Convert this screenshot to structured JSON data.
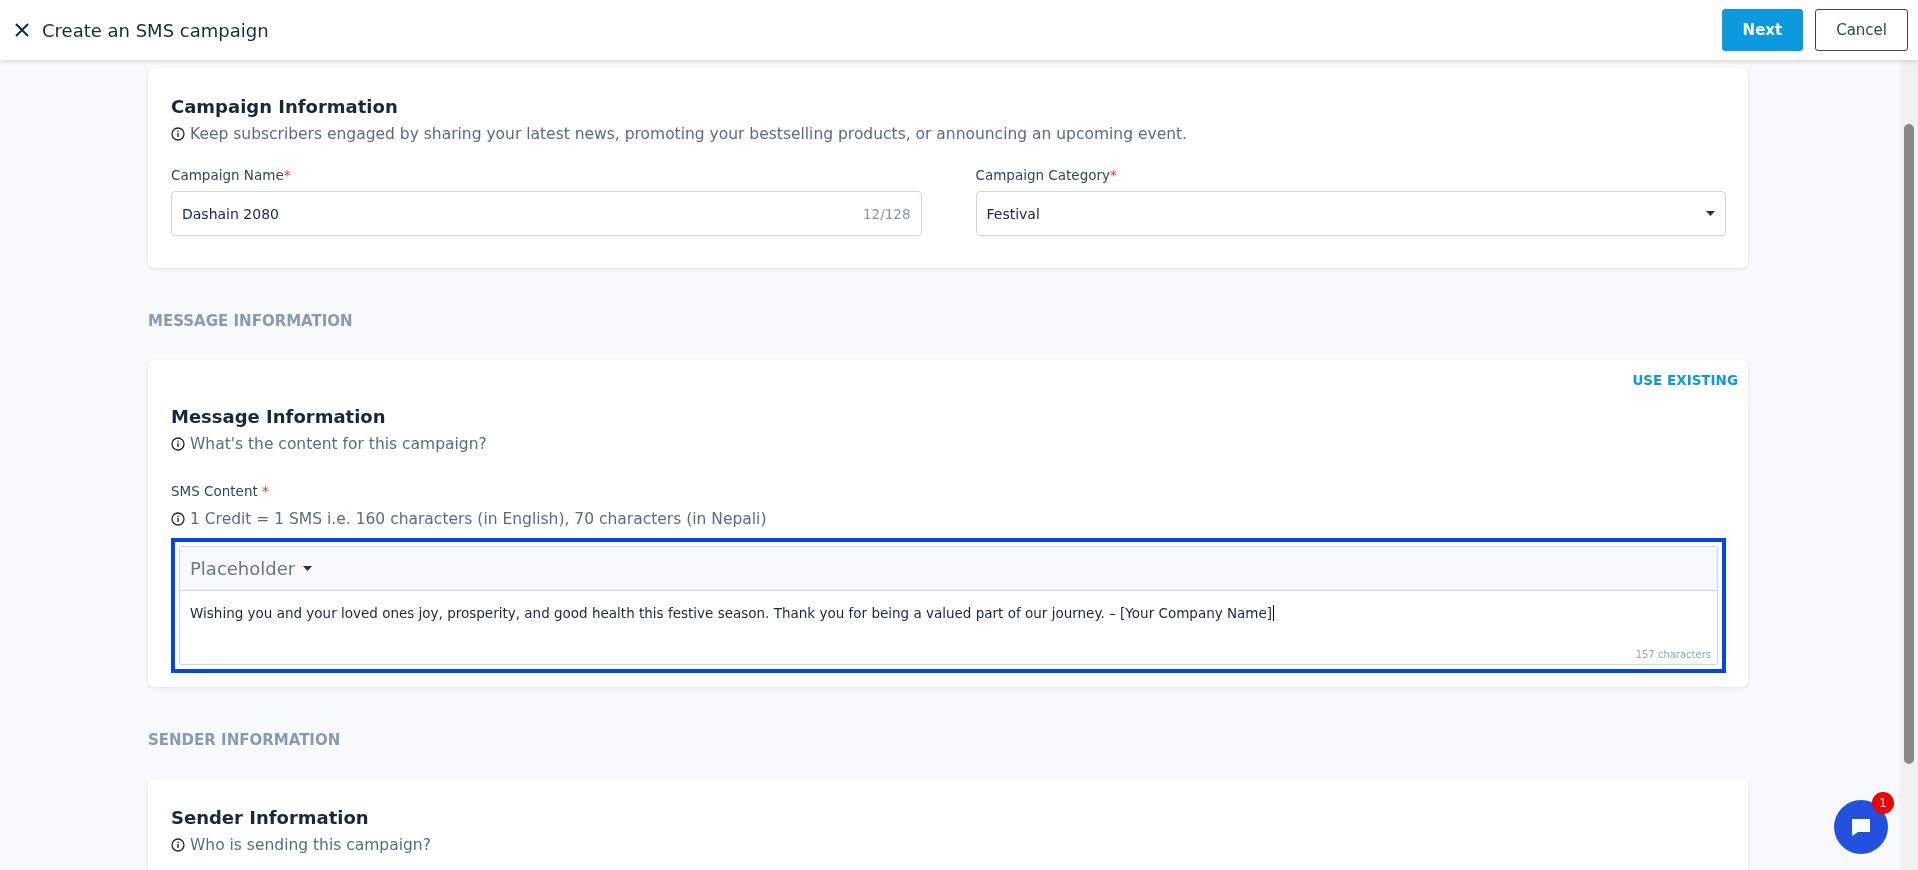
{
  "header": {
    "title": "Create an SMS campaign",
    "buttons": [
      {
        "label": "Next",
        "kind": "primary"
      },
      {
        "label": "Cancel",
        "kind": "secondary"
      }
    ]
  },
  "campaign": {
    "title": "Campaign Information",
    "hint": "Keep subscribers engaged by sharing your latest news, promoting your bestselling products, or announcing an upcoming event.",
    "fields": [
      {
        "kind": "text",
        "label": "Campaign Name",
        "required_mark": "*",
        "value": "Dashain 2080",
        "counter": "12/128"
      },
      {
        "kind": "select",
        "label": "Campaign Category",
        "required_mark": "*",
        "value": "Festival"
      }
    ]
  },
  "message_section": {
    "heading": "MESSAGE INFORMATION",
    "link": "USE EXISTING",
    "title": "Message Information",
    "hint": "What's the content for this campaign?",
    "content_label": "SMS Content",
    "required_mark": "*",
    "credit_hint": "1 Credit = 1 SMS i.e. 160 characters (in English), 70 characters (in Nepali)",
    "editor": {
      "focused": true,
      "placeholder_menu": "Placeholder",
      "value": "Wishing you and your loved ones joy, prosperity, and good health this festive season. Thank you for being a valued part of our journey. – [Your Company Name]",
      "count": "157 characters"
    }
  },
  "sender_section": {
    "heading": "SENDER INFORMATION",
    "title": "Sender Information",
    "hint": "Who is sending this campaign?"
  },
  "chat": {
    "badge": "1"
  }
}
